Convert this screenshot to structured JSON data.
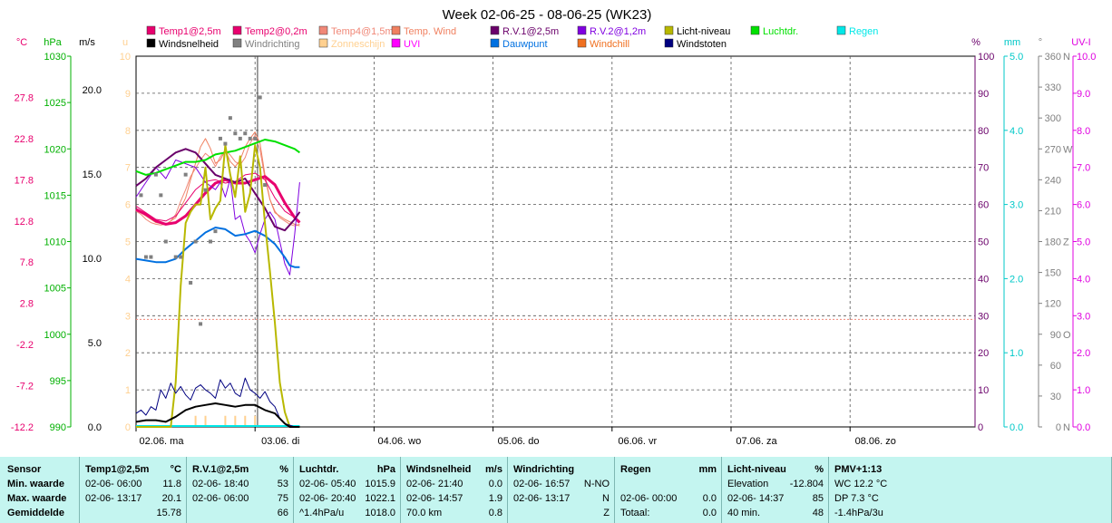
{
  "chart_data": {
    "type": "line",
    "title": "Week 02-06-25 - 08-06-25 (WK23)",
    "x_days": [
      "02.06.  ma",
      "03.06.  di",
      "04.06.  wo",
      "05.06.  do",
      "06.06.  vr",
      "07.06.  za",
      "08.06.  zo"
    ],
    "x_units": "hours since 02.06. 00:00",
    "legend": [
      {
        "name": "Temp1@2,5m",
        "color": "#e8006e"
      },
      {
        "name": "Temp2@0,2m",
        "color": "#e8006e"
      },
      {
        "name": "Temp4@1,5m",
        "color": "#f08878"
      },
      {
        "name": "Temp. Wind",
        "color": "#f08060"
      },
      {
        "name": "R.V.1@2,5m",
        "color": "#6a006a"
      },
      {
        "name": "R.V.2@1,2m",
        "color": "#8000e0"
      },
      {
        "name": "Licht-niveau",
        "color": "#b8b800"
      },
      {
        "name": "Luchtdr.",
        "color": "#00e000"
      },
      {
        "name": "Regen",
        "color": "#00e8e8"
      },
      {
        "name": "Windsnelheid",
        "color": "#000000"
      },
      {
        "name": "Windrichting",
        "color": "#808080"
      },
      {
        "name": "Zonneschijn",
        "color": "#ffd090"
      },
      {
        "name": "UVI",
        "color": "#ff00ff"
      },
      {
        "name": "Dauwpunt",
        "color": "#0070e0"
      },
      {
        "name": "Windchill",
        "color": "#f07020"
      },
      {
        "name": "Windstoten",
        "color": "#000080"
      }
    ],
    "axes": {
      "temp": {
        "unit": "°C",
        "color": "#e8006e",
        "min": -12.2,
        "max": 32.8,
        "ticks": [
          "27.8",
          "22.8",
          "17.8",
          "12.8",
          "7.8",
          "2.8",
          "-2.2",
          "-7.2",
          "-12.2"
        ]
      },
      "pressure": {
        "unit": "hPa",
        "color": "#00b000",
        "min": 990,
        "max": 1030,
        "ticks": [
          "1030",
          "1025",
          "1020",
          "1015",
          "1010",
          "1005",
          "1000",
          "995",
          "990"
        ]
      },
      "wind": {
        "unit": "m/s",
        "color": "#000000",
        "min": 0,
        "max": 22.0,
        "ticks": [
          "20.0",
          "15.0",
          "10.0",
          "5.0",
          "0.0"
        ]
      },
      "light": {
        "unit": "u",
        "color": "#ffd090",
        "min": 0,
        "max": 10,
        "ticks": [
          "10",
          "9",
          "8",
          "7",
          "6",
          "5",
          "4",
          "3",
          "2",
          "1",
          "0"
        ]
      },
      "percent": {
        "unit": "%",
        "color": "#6a006a",
        "min": 0,
        "max": 100,
        "ticks": [
          "100",
          "90",
          "80",
          "70",
          "60",
          "50",
          "40",
          "30",
          "20",
          "10",
          "0"
        ]
      },
      "rain": {
        "unit": "mm",
        "color": "#00c8c8",
        "min": 0,
        "max": 5.0,
        "ticks": [
          "5.0",
          "4.0",
          "3.0",
          "2.0",
          "1.0",
          "0.0"
        ]
      },
      "direction": {
        "unit": "°",
        "color": "#808080",
        "ticks": [
          "360",
          "330",
          "300",
          "270",
          "240",
          "210",
          "180",
          "150",
          "120",
          "90",
          "60",
          "30",
          "0"
        ],
        "compass": {
          "360": "N",
          "270": "W",
          "180": "Z",
          "90": "O",
          "0": "N"
        }
      },
      "uvi": {
        "unit": "UV-I",
        "color": "#e000e0",
        "min": 0,
        "max": 10.0,
        "ticks": [
          "10.0",
          "9.0",
          "8.0",
          "7.0",
          "6.0",
          "5.0",
          "4.0",
          "3.0",
          "2.0",
          "1.0",
          "0.0"
        ]
      }
    },
    "reference_line_percent": 29,
    "series": [
      {
        "name": "Temp4@1,5m",
        "axis": "temp",
        "color": "#f08878",
        "width": 1,
        "x": [
          0,
          1,
          2,
          3,
          4,
          5,
          6,
          7,
          8,
          9,
          10,
          11,
          12,
          13,
          14,
          15,
          16,
          17,
          18,
          19,
          20,
          21,
          22,
          23,
          24,
          25,
          26,
          27,
          28,
          29,
          30,
          31,
          32,
          33
        ],
        "y": [
          14.0,
          13.6,
          13.0,
          12.6,
          12.4,
          12.3,
          12.4,
          12.8,
          13.6,
          15.2,
          16.6,
          18.2,
          19.2,
          20.2,
          21.0,
          20.5,
          19.4,
          20.6,
          21.4,
          20.8,
          20.0,
          19.6,
          20.5,
          22.2,
          23.2,
          21.4,
          18.0,
          15.4,
          14.0,
          13.2,
          12.8,
          12.4,
          12.2,
          12.4
        ]
      },
      {
        "name": "Temp. Wind",
        "axis": "temp",
        "color": "#f08060",
        "width": 1,
        "x": [
          0,
          2,
          4,
          6,
          8,
          10,
          11,
          12,
          13,
          14,
          15,
          16,
          17,
          18,
          19,
          20,
          21,
          22,
          23,
          24,
          25,
          26,
          27,
          28,
          30,
          32,
          33
        ],
        "y": [
          14.2,
          13.4,
          12.6,
          12.4,
          13.2,
          15.6,
          17.8,
          19.8,
          21.8,
          22.8,
          21.6,
          19.8,
          20.2,
          21.4,
          20.0,
          19.4,
          20.2,
          21.8,
          22.8,
          23.6,
          22.2,
          18.4,
          15.4,
          13.8,
          13.0,
          12.4,
          12.2
        ]
      },
      {
        "name": "Temp2@0,2m",
        "axis": "temp",
        "color": "#e8006e",
        "width": 1,
        "x": [
          0,
          2,
          4,
          6,
          8,
          10,
          12,
          14,
          16,
          18,
          20,
          22,
          24,
          26,
          28,
          30,
          32,
          33
        ],
        "y": [
          14.6,
          13.8,
          13.0,
          12.8,
          13.4,
          15.0,
          16.6,
          17.6,
          17.8,
          17.4,
          17.6,
          18.4,
          18.6,
          17.8,
          15.6,
          14.0,
          13.2,
          12.8
        ]
      },
      {
        "name": "Temp1@2,5m",
        "axis": "temp",
        "color": "#e8006e",
        "width": 3,
        "x": [
          0,
          2,
          4,
          6,
          8,
          10,
          12,
          14,
          16,
          18,
          20,
          22,
          24,
          26,
          28,
          30,
          32,
          33
        ],
        "y": [
          14.2,
          13.6,
          12.8,
          12.4,
          12.6,
          13.4,
          14.8,
          16.2,
          17.4,
          17.8,
          17.4,
          17.4,
          17.8,
          18.2,
          17.2,
          15.0,
          13.2,
          12.6
        ]
      },
      {
        "name": "R.V.2@1,2m",
        "axis": "percent",
        "color": "#8000e0",
        "width": 1,
        "x": [
          0,
          2,
          4,
          6,
          8,
          10,
          12,
          14,
          16,
          17,
          18,
          19,
          20,
          21,
          22,
          23,
          24,
          25,
          26,
          27,
          28,
          29,
          30,
          31,
          32,
          33
        ],
        "y": [
          62,
          66,
          70,
          67,
          72,
          71,
          70,
          66,
          64,
          66,
          62,
          67,
          56,
          57,
          52,
          50,
          47,
          52,
          56,
          58,
          56,
          50,
          44,
          41,
          52,
          66
        ]
      },
      {
        "name": "R.V.1@2,5m",
        "axis": "percent",
        "color": "#6a006a",
        "width": 2,
        "x": [
          0,
          2,
          4,
          6,
          8,
          10,
          12,
          14,
          16,
          18,
          20,
          22,
          24,
          26,
          28,
          30,
          32,
          33
        ],
        "y": [
          65,
          67,
          70,
          72,
          74,
          75,
          74,
          71,
          68,
          67,
          66,
          67,
          63,
          59,
          54,
          53,
          56,
          58
        ]
      },
      {
        "name": "Dauwpunt",
        "axis": "temp",
        "color": "#0070e0",
        "width": 2,
        "x": [
          0,
          2,
          4,
          6,
          8,
          10,
          12,
          14,
          16,
          18,
          20,
          22,
          24,
          26,
          28,
          30,
          31,
          32,
          33
        ],
        "y": [
          8.2,
          8.0,
          7.8,
          7.8,
          8.2,
          9.4,
          10.4,
          11.4,
          12.0,
          11.8,
          11.0,
          11.2,
          11.6,
          11.0,
          10.0,
          8.4,
          7.4,
          7.2,
          7.2
        ]
      },
      {
        "name": "Luchtdr.",
        "axis": "pressure",
        "color": "#00e000",
        "width": 2,
        "x": [
          0,
          2,
          4,
          6,
          8,
          10,
          12,
          14,
          16,
          18,
          20,
          22,
          24,
          26,
          28,
          30,
          32,
          33
        ],
        "y": [
          1017.6,
          1017.2,
          1017.4,
          1017.8,
          1018.2,
          1018.6,
          1018.6,
          1018.8,
          1019.4,
          1019.6,
          1019.8,
          1020.2,
          1020.6,
          1021.0,
          1020.8,
          1020.4,
          1020.0,
          1019.6
        ]
      },
      {
        "name": "Licht-niveau",
        "axis": "light",
        "color": "#b8b800",
        "width": 2,
        "x": [
          0,
          4,
          5,
          6,
          7,
          8,
          9,
          10,
          11,
          12,
          13,
          14,
          15,
          16,
          17,
          18,
          19,
          20,
          21,
          22,
          23,
          24,
          25,
          26,
          27,
          28,
          29,
          30,
          31,
          32,
          33
        ],
        "y": [
          0,
          0,
          0,
          0,
          0,
          1.2,
          3.8,
          5.5,
          5.8,
          6.0,
          6.0,
          7.0,
          5.6,
          5.9,
          6.1,
          7.6,
          6.8,
          6.2,
          7.3,
          5.8,
          6.3,
          7.6,
          7.0,
          5.5,
          4.2,
          2.8,
          1.2,
          0.4,
          0,
          0,
          0
        ]
      },
      {
        "name": "Windstoten",
        "axis": "wind",
        "color": "#000080",
        "width": 1,
        "x": [
          0,
          1,
          2,
          3,
          4,
          5,
          6,
          7,
          8,
          9,
          10,
          11,
          12,
          13,
          14,
          15,
          16,
          17,
          18,
          19,
          20,
          21,
          22,
          23,
          24,
          25,
          26,
          27,
          28,
          29,
          30,
          31,
          32,
          33
        ],
        "y": [
          0.8,
          1.0,
          0.7,
          1.2,
          1.0,
          2.2,
          1.7,
          2.6,
          2.0,
          2.4,
          1.9,
          1.6,
          2.3,
          2.5,
          2.2,
          2.0,
          1.7,
          2.8,
          2.3,
          2.6,
          2.0,
          1.8,
          2.9,
          2.2,
          2.0,
          1.7,
          2.1,
          1.5,
          1.2,
          0.5,
          0.2,
          0.1,
          0,
          0
        ]
      },
      {
        "name": "Windsnelheid",
        "axis": "wind",
        "color": "#000000",
        "width": 2,
        "x": [
          0,
          2,
          4,
          6,
          8,
          10,
          12,
          14,
          16,
          18,
          20,
          22,
          24,
          26,
          28,
          29,
          30,
          31,
          32,
          33
        ],
        "y": [
          0.3,
          0.4,
          0.4,
          0.3,
          0.6,
          1.0,
          1.2,
          1.3,
          1.4,
          1.3,
          1.2,
          1.3,
          1.3,
          1.0,
          0.8,
          0.5,
          0.2,
          0,
          0,
          0
        ]
      }
    ],
    "windrichting_points": {
      "axis": "direction",
      "color": "#808080",
      "x": [
        1,
        2,
        3,
        4,
        5,
        6,
        8,
        9,
        10,
        11,
        12,
        13,
        14,
        15,
        16,
        17,
        18,
        19,
        20,
        21,
        22,
        23,
        24,
        25,
        26
      ],
      "y": [
        225,
        165,
        165,
        245,
        225,
        180,
        165,
        165,
        245,
        140,
        180,
        100,
        230,
        180,
        190,
        280,
        275,
        300,
        285,
        280,
        285,
        280,
        280,
        320,
        235
      ]
    },
    "zonneschijn_bars": {
      "axis": "light",
      "color": "#ffd090",
      "x": [
        12,
        14,
        18,
        20,
        22,
        24
      ],
      "y": [
        0.3,
        0.3,
        0.3,
        0.3,
        0.3,
        0.3
      ]
    },
    "regen": {
      "axis": "rain",
      "color": "#00e8e8",
      "x": [
        0,
        33
      ],
      "y": [
        0,
        0
      ]
    }
  },
  "stats": {
    "labels": {
      "title": "Sensor",
      "min": "Min. waarde",
      "max": "Max. waarde",
      "avg": "Gemiddelde"
    },
    "columns": [
      {
        "title": "Temp1@2,5m",
        "unit": "°C",
        "min": {
          "time": "02-06-  06:00",
          "value": "11.8"
        },
        "max": {
          "time": "02-06-  13:17",
          "value": "20.1"
        },
        "avg": {
          "time": "",
          "value": "15.78"
        }
      },
      {
        "title": "R.V.1@2,5m",
        "unit": "%",
        "min": {
          "time": "02-06-  18:40",
          "value": "53"
        },
        "max": {
          "time": "02-06-  06:00",
          "value": "75"
        },
        "avg": {
          "time": "",
          "value": "66"
        }
      },
      {
        "title": "Luchtdr.",
        "unit": "hPa",
        "min": {
          "time": "02-06-  05:40",
          "value": "1015.9"
        },
        "max": {
          "time": "02-06-  20:40",
          "value": "1022.1"
        },
        "avg": {
          "time": "^1.4hPa/u",
          "value": "1018.0"
        }
      },
      {
        "title": "Windsnelheid",
        "unit": "m/s",
        "min": {
          "time": "02-06-  21:40",
          "value": "0.0"
        },
        "max": {
          "time": "02-06-  14:57",
          "value": "1.9"
        },
        "avg": {
          "time": "70.0 km",
          "value": "0.8"
        }
      },
      {
        "title": "Windrichting",
        "unit": "",
        "min": {
          "time": "02-06-  16:57",
          "value": "N-NO"
        },
        "max": {
          "time": "02-06-  13:17",
          "value": "N"
        },
        "avg": {
          "time": "",
          "value": "Z"
        }
      },
      {
        "title": "Regen",
        "unit": "mm",
        "min": {
          "time": "",
          "value": ""
        },
        "max": {
          "time": "02-06-  00:00",
          "value": "0.0"
        },
        "avg": {
          "time": "Totaal:",
          "value": "0.0"
        }
      },
      {
        "title": "Licht-niveau",
        "unit": "%",
        "min": {
          "time": "Elevation",
          "value": "-12.804"
        },
        "max": {
          "time": "02-06-  14:37",
          "value": "85"
        },
        "avg": {
          "time": "40 min.",
          "value": "48"
        }
      },
      {
        "title": "PMV+1:13",
        "unit": "",
        "min": {
          "time": "WC 12.2 °C",
          "value": ""
        },
        "max": {
          "time": "DP 7.3 °C",
          "value": ""
        },
        "avg": {
          "time": "-1.4hPa/3u",
          "value": ""
        }
      }
    ]
  }
}
